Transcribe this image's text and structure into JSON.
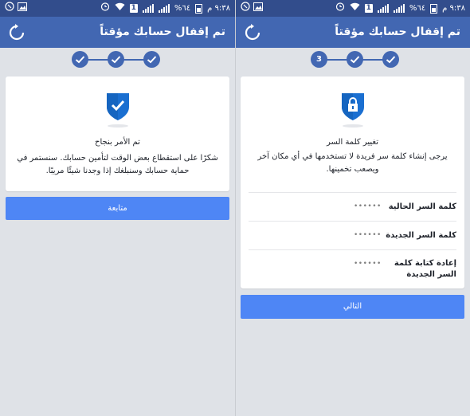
{
  "colors": {
    "status_bar": "#324d8c",
    "app_bar": "#4267b2",
    "button": "#4e86f5",
    "background": "#dfe2e7",
    "card": "#ffffff"
  },
  "status_bar": {
    "time": "٩:٣٨ م",
    "battery_percent": "%٦٤",
    "sim_slot": "1",
    "icons": [
      "signal-icon",
      "sim-icon",
      "wifi-icon",
      "alarm-icon",
      "phone-icon",
      "gallery-icon"
    ]
  },
  "left": {
    "app_title": "تم إقفال حسابك مؤقتاً",
    "refresh_icon": "refresh-icon",
    "steps": [
      {
        "done": true
      },
      {
        "done": true
      },
      {
        "done": true
      }
    ],
    "card": {
      "shield_icon": "check-shield-icon",
      "title": "تم الأمر بنجاح",
      "description": "شكرًا على استقطاع بعض الوقت لتأمين حسابك. سنستمر في حماية حسابك وسنبلغك إذا وجدنا شيئًا مريبًا."
    },
    "button_label": "متابعة"
  },
  "right": {
    "app_title": "تم إقفال حسابك مؤقتاً",
    "refresh_icon": "refresh-icon",
    "steps": [
      {
        "label": "3",
        "done": false
      },
      {
        "done": true
      },
      {
        "done": true
      }
    ],
    "card": {
      "shield_icon": "lock-shield-icon",
      "title": "تغيير كلمة السر",
      "description": "يرجى إنشاء كلمة سر فريدة لا تستخدمها في أي مكان آخر ويصعب تخمينها.",
      "fields": [
        {
          "label": "كلمة السر الحالية",
          "value": "••••••"
        },
        {
          "label": "كلمة السر الجديدة",
          "value": "••••••"
        },
        {
          "label": "إعادة كتابة كلمة السر الجديدة",
          "value": "••••••"
        }
      ]
    },
    "button_label": "التالي"
  }
}
